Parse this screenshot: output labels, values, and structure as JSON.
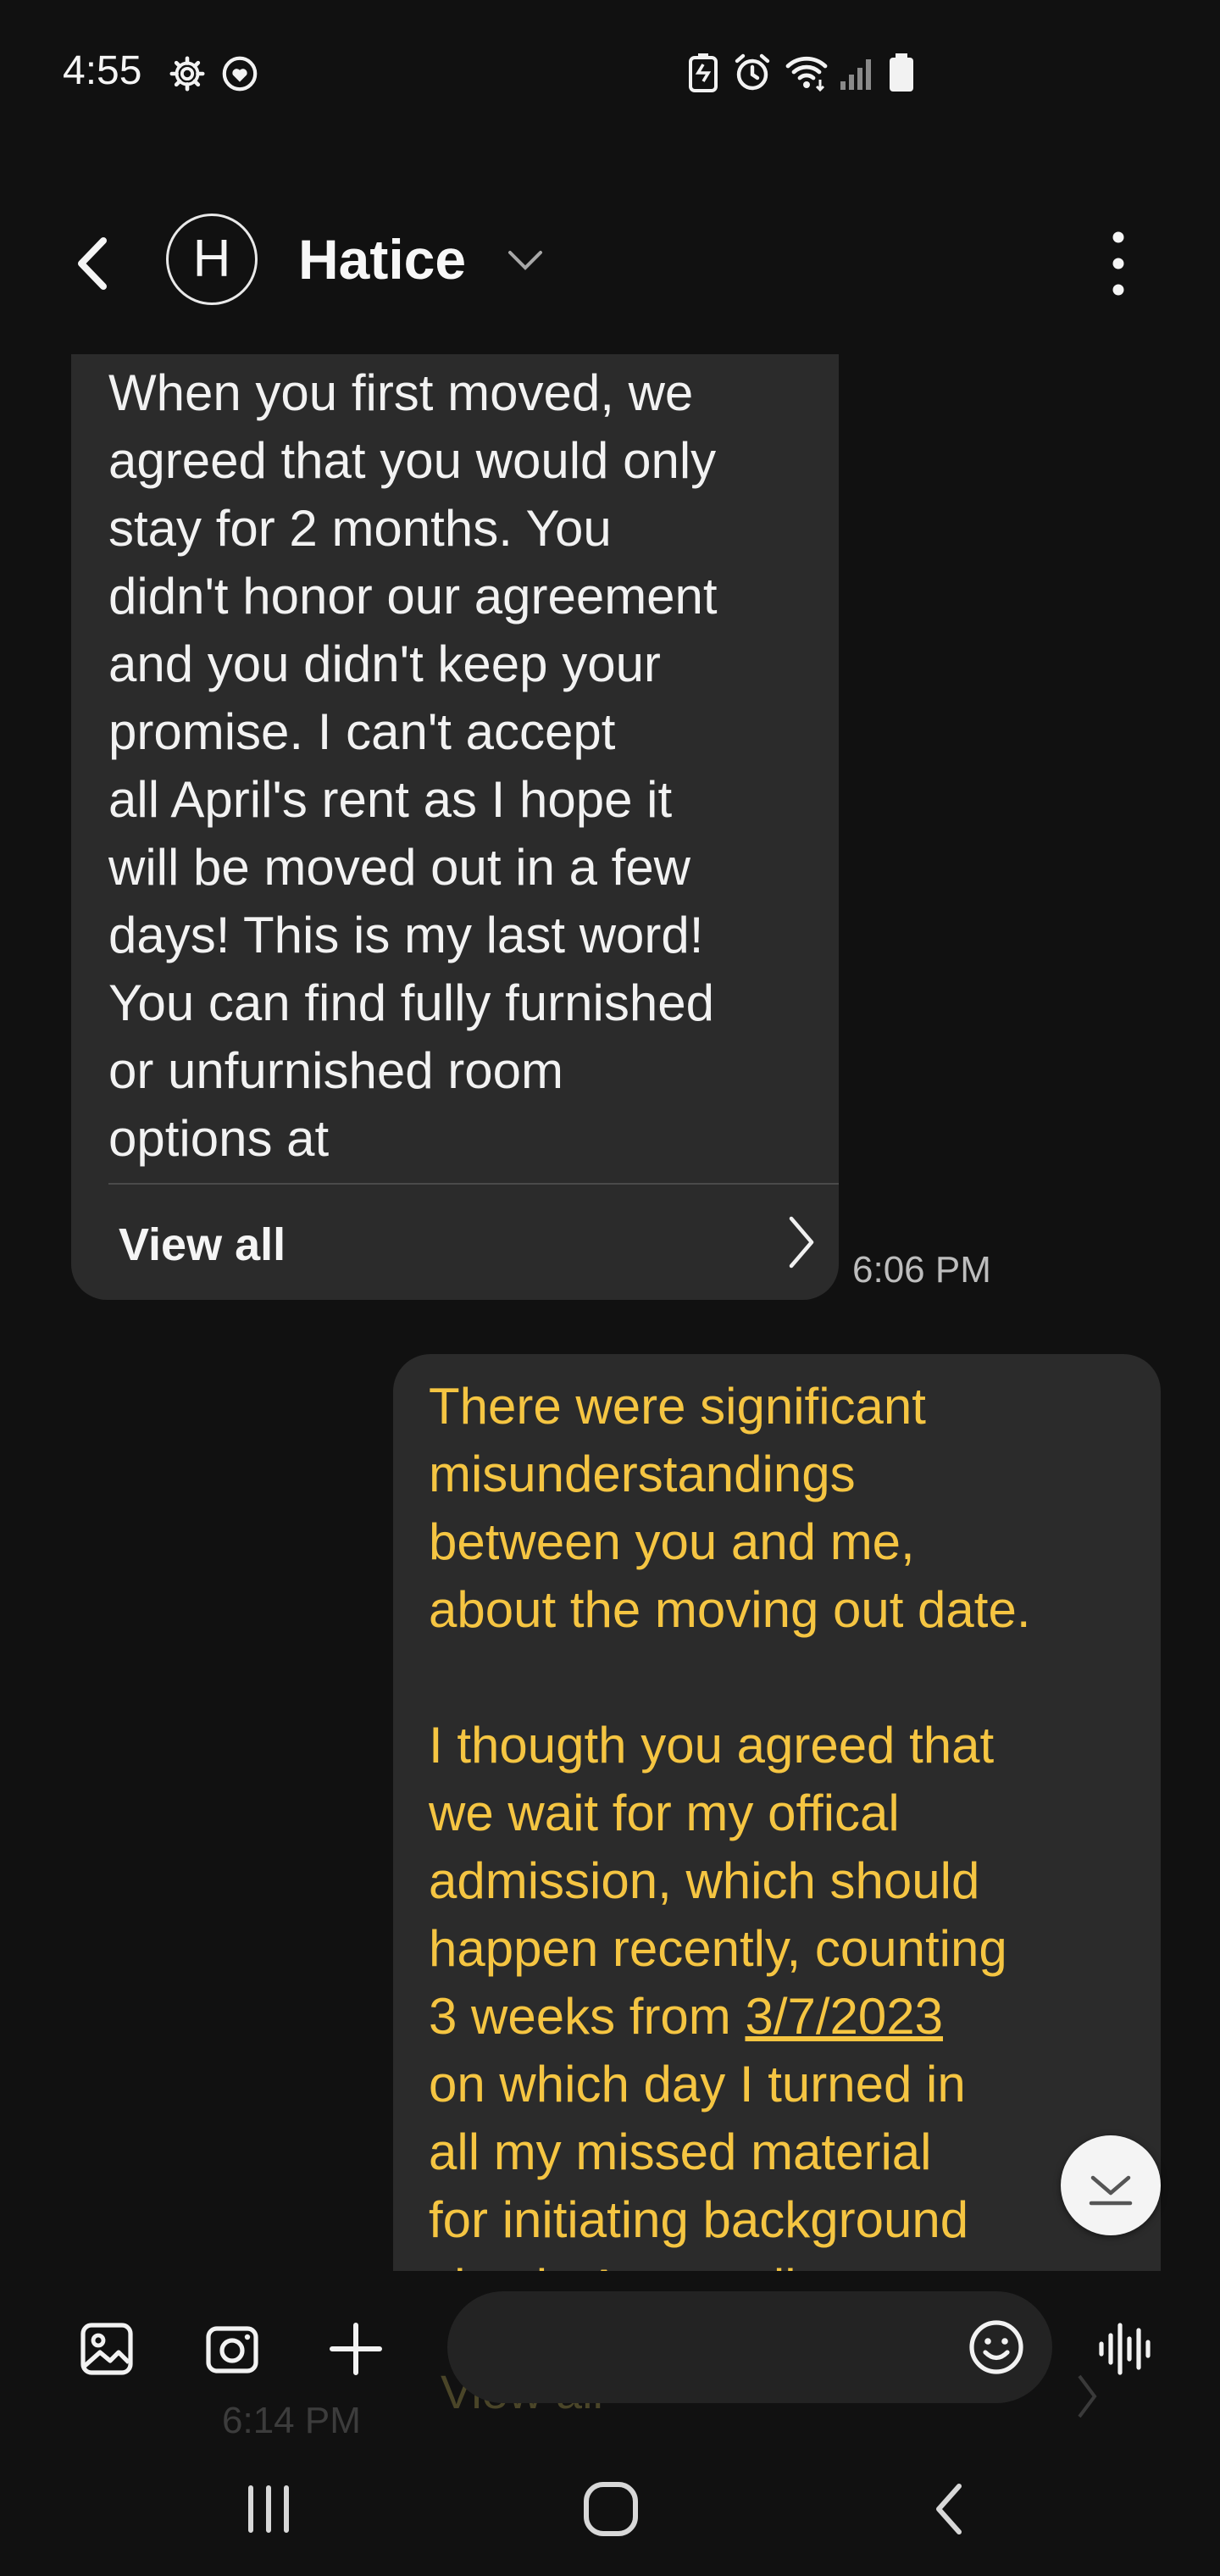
{
  "status_bar": {
    "time": "4:55",
    "icons": [
      "settings-icon",
      "heart-shield-icon",
      "battery-saver-icon",
      "alarm-icon",
      "wifi-icon",
      "signal-icon",
      "battery-icon"
    ]
  },
  "header": {
    "avatar_initial": "H",
    "contact_name": "Hatice"
  },
  "messages": [
    {
      "direction": "incoming",
      "text": "When you first moved, we\nagreed that you would only\nstay for 2 months.  You\ndidn't honor our agreement\nand you didn't keep your\npromise.  I can't accept\nall April's rent as I hope it\nwill be moved out in a few\ndays!  This is my last word!\nYou can find fully furnished\nor unfurnished room\noptions at",
      "view_all_label": "View all",
      "time": "6:06 PM"
    },
    {
      "direction": "outgoing",
      "text_before_link": "There were significant\nmisunderstandings\nbetween you and me,\nabout the moving out date.\n\nI thougth you agreed that\nwe wait for my offical\nadmission, which should\nhappen recently, counting\n3 weeks from ",
      "link_text": "3/7/2023",
      "text_after_link": "\non which day I turned in\nall my missed material\nfor initiating background\ncheck. As you di",
      "view_all_label": "View all",
      "time": "6:14 PM"
    }
  ],
  "composer": {
    "icons": [
      "gallery-icon",
      "camera-icon",
      "plus-icon",
      "emoji-icon",
      "voice-icon"
    ]
  },
  "colors": {
    "background": "#111111",
    "bubble": "#2b2b2b",
    "incoming_text": "#f2f2f2",
    "outgoing_text": "#f5c542"
  }
}
